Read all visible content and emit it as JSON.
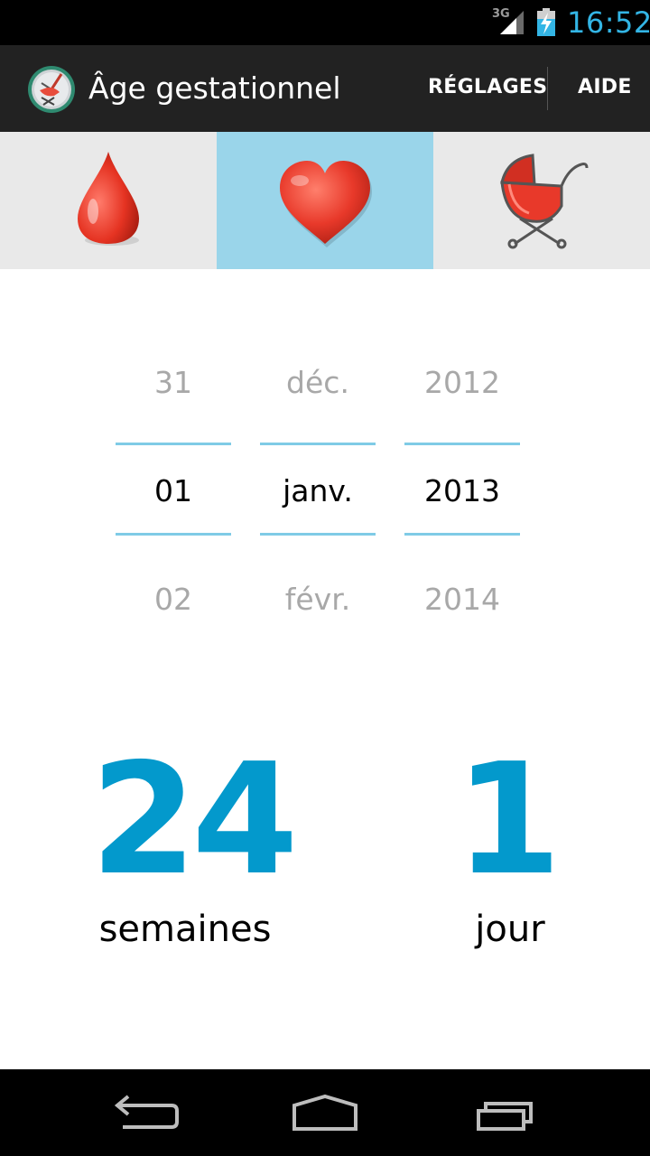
{
  "status_bar": {
    "network": "3G",
    "time": "16:52",
    "icons": [
      "signal-icon",
      "battery-charging-icon"
    ]
  },
  "action_bar": {
    "title": "Âge gestationnel",
    "settings_label": "RÉGLAGES",
    "help_label": "AIDE",
    "icon": "app-logo-icon"
  },
  "tabs": [
    {
      "icon": "blood-drop-icon",
      "active": false
    },
    {
      "icon": "heart-icon",
      "active": true
    },
    {
      "icon": "baby-carriage-icon",
      "active": false
    }
  ],
  "picker": {
    "day": {
      "prev": "31",
      "current": "01",
      "next": "02"
    },
    "month": {
      "prev": "déc.",
      "current": "janv.",
      "next": "févr."
    },
    "year": {
      "prev": "2012",
      "current": "2013",
      "next": "2014"
    }
  },
  "result": {
    "weeks_value": "24",
    "weeks_unit": "semaines",
    "days_value": "1",
    "days_unit": "jour"
  },
  "nav_bar": {
    "icons": [
      "back-icon",
      "home-icon",
      "recent-apps-icon"
    ]
  },
  "colors": {
    "accent": "#33b5e5",
    "result": "#0399cc",
    "active_tab": "#9ad5ea",
    "action_bar": "#222222",
    "selection_line": "#7fcbe6"
  }
}
